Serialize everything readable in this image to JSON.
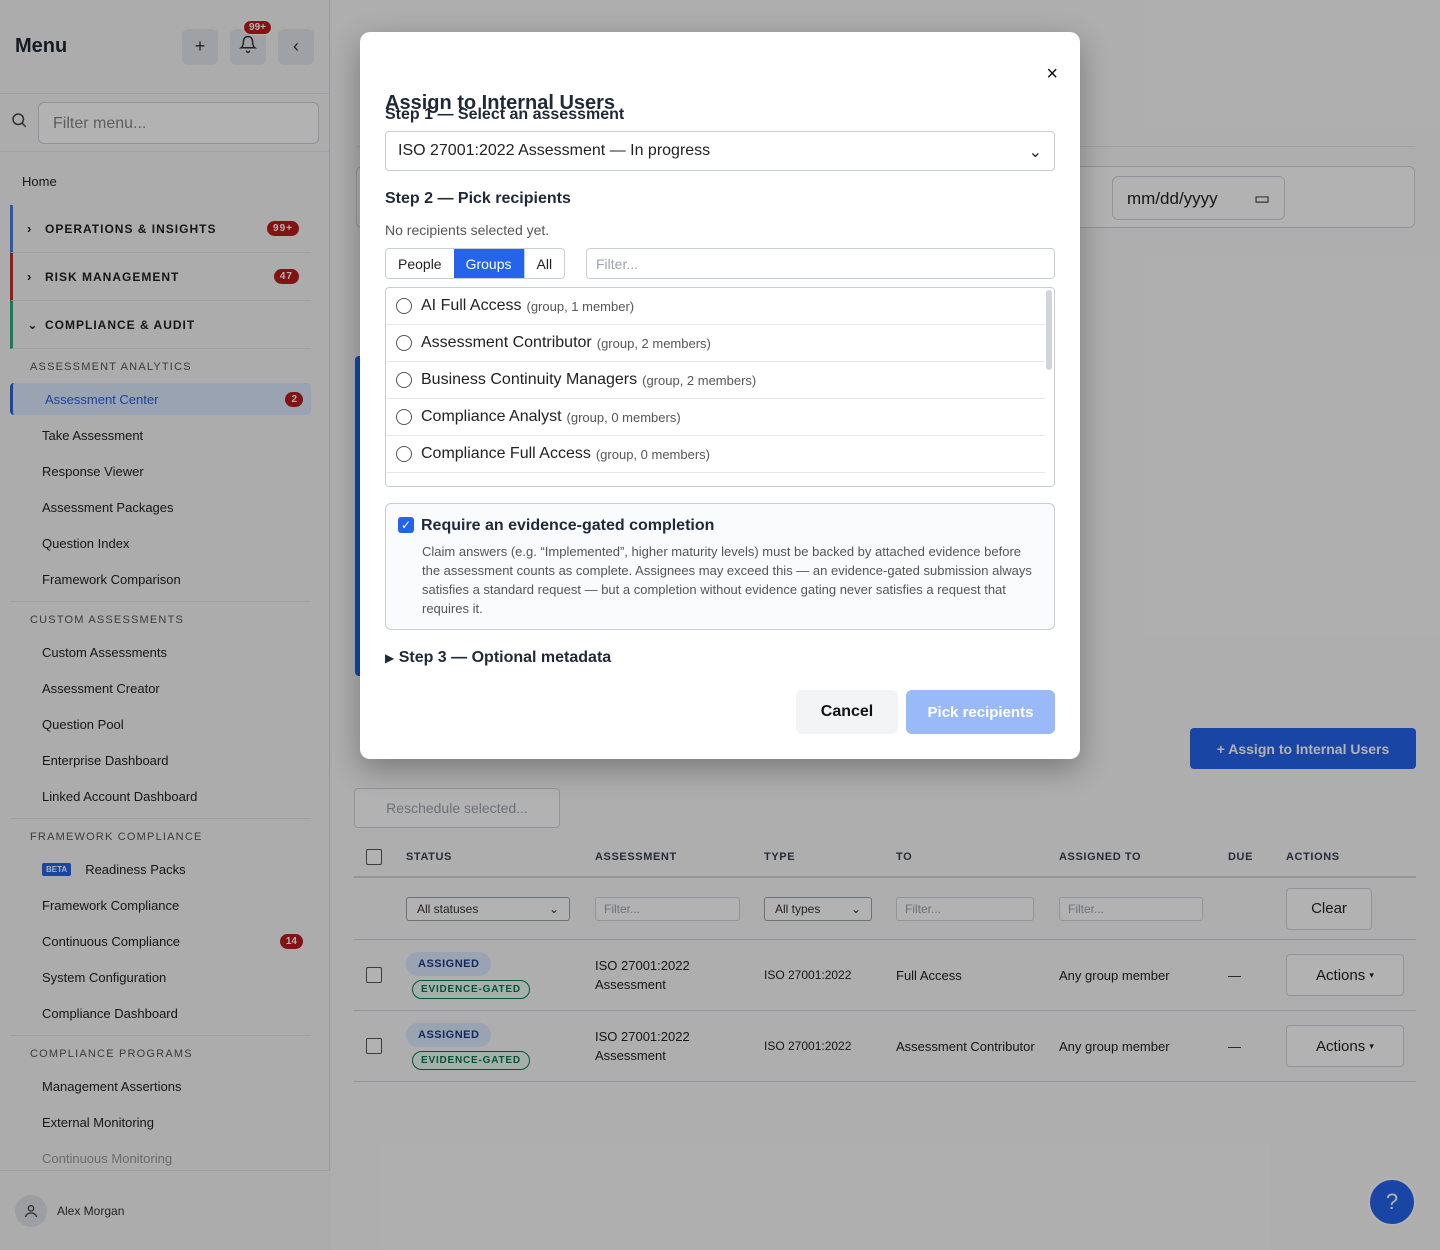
{
  "sidebar": {
    "title": "Menu",
    "notif_badge": "99+",
    "filter_placeholder": "Filter menu...",
    "home": "Home",
    "groups": [
      {
        "label": "OPERATIONS & INSIGHTS",
        "count": "99+"
      },
      {
        "label": "RISK MANAGEMENT",
        "count": "47"
      },
      {
        "label": "COMPLIANCE & AUDIT"
      }
    ],
    "sections": {
      "assessment_analytics": "ASSESSMENT ANALYTICS",
      "custom_assessments": "CUSTOM ASSESSMENTS",
      "framework_compliance": "FRAMEWORK COMPLIANCE",
      "compliance_programs": "COMPLIANCE PROGRAMS"
    },
    "items": {
      "assessment_center": "Assessment Center",
      "assessment_center_count": "2",
      "take_assessment": "Take Assessment",
      "response_viewer": "Response Viewer",
      "assessment_packages": "Assessment Packages",
      "question_index": "Question Index",
      "framework_comparison": "Framework Comparison",
      "custom_assessments": "Custom Assessments",
      "assessment_creator": "Assessment Creator",
      "question_pool": "Question Pool",
      "enterprise_dashboard": "Enterprise Dashboard",
      "linked_account_dashboard": "Linked Account Dashboard",
      "beta": "BETA",
      "readiness_packs": "Readiness Packs",
      "framework_compliance": "Framework Compliance",
      "continuous_compliance": "Continuous Compliance",
      "continuous_compliance_count": "14",
      "system_configuration": "System Configuration",
      "compliance_dashboard": "Compliance Dashboard",
      "management_assertions": "Management Assertions",
      "external_monitoring": "External Monitoring",
      "continuous_monitoring": "Continuous Monitoring"
    },
    "user": "Alex Morgan"
  },
  "main": {
    "date_placeholder": "mm/dd/yyyy",
    "assign_button": "+ Assign to Internal Users",
    "reschedule_button": "Reschedule selected...",
    "table": {
      "headers": [
        "STATUS",
        "ASSESSMENT",
        "TYPE",
        "TO",
        "ASSIGNED TO",
        "DUE",
        "ACTIONS"
      ],
      "status_filter": "All statuses",
      "type_filter": "All types",
      "filter_placeholder": "Filter...",
      "clear": "Clear",
      "rows": [
        {
          "status": "ASSIGNED",
          "tag": "EVIDENCE-GATED",
          "assessment": "ISO 27001:2022 Assessment",
          "type": "ISO 27001:2022",
          "to": "Full Access",
          "assigned_to": "Any group member",
          "due": "—",
          "action": "Actions"
        },
        {
          "status": "ASSIGNED",
          "tag": "EVIDENCE-GATED",
          "assessment": "ISO 27001:2022 Assessment",
          "type": "ISO 27001:2022",
          "to": "Assessment Contributor",
          "assigned_to": "Any group member",
          "due": "—",
          "action": "Actions"
        }
      ]
    }
  },
  "modal": {
    "title": "Assign to Internal Users",
    "close": "×",
    "step1": "Step 1 — Select an assessment",
    "assessment_selected": "ISO 27001:2022 Assessment — In progress",
    "step2": "Step 2 — Pick recipients",
    "no_recipients": "No recipients selected yet.",
    "tabs": [
      "People",
      "Groups",
      "All"
    ],
    "filter_placeholder": "Filter...",
    "groups": [
      {
        "name": "AI Full Access",
        "meta": "(group, 1 member)"
      },
      {
        "name": "Assessment Contributor",
        "meta": "(group, 2 members)"
      },
      {
        "name": "Business Continuity Managers",
        "meta": "(group, 2 members)"
      },
      {
        "name": "Compliance Analyst",
        "meta": "(group, 0 members)"
      },
      {
        "name": "Compliance Full Access",
        "meta": "(group, 0 members)"
      }
    ],
    "evidence_title": "Require an evidence-gated completion",
    "evidence_text": "Claim answers (e.g. “Implemented”, higher maturity levels) must be backed by attached evidence before the assessment counts as complete. Assignees may exceed this — an evidence-gated submission always satisfies a standard request — but a completion without evidence gating never satisfies a request that requires it.",
    "step3": "Step 3 — Optional metadata",
    "cancel": "Cancel",
    "pick": "Pick recipients"
  }
}
